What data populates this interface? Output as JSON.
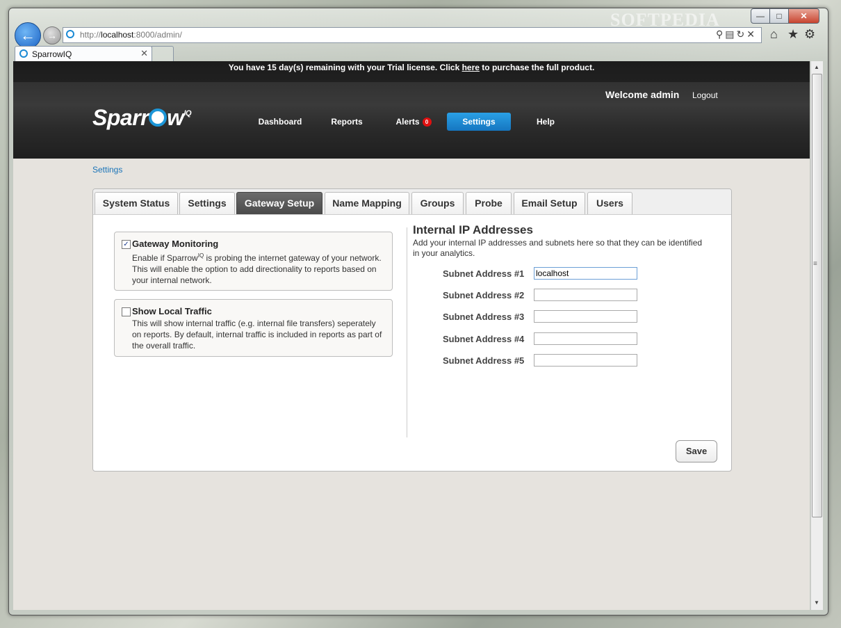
{
  "browser": {
    "watermark": "SOFTPEDIA",
    "url_prefix": "http://",
    "url_host": "localhost",
    "url_rest": ":8000/admin/",
    "tab_title": "SparrowIQ"
  },
  "site": {
    "trial_before": "You have 15 day(s) remaining with your Trial license. Click ",
    "trial_link": "here",
    "trial_after": " to purchase the full product.",
    "welcome": "Welcome admin",
    "logout": "Logout",
    "logo_a": "Sparr",
    "logo_b": "w",
    "logo_sup": "IQ",
    "nav": {
      "dashboard": "Dashboard",
      "reports": "Reports",
      "alerts": "Alerts",
      "alerts_count": "0",
      "settings": "Settings",
      "help": "Help"
    },
    "breadcrumb": "Settings"
  },
  "tabs": [
    "System Status",
    "Settings",
    "Gateway Setup",
    "Name Mapping",
    "Groups",
    "Probe",
    "Email Setup",
    "Users"
  ],
  "active_tab": "Gateway Setup",
  "options": {
    "gateway": {
      "checked": true,
      "title": "Gateway Monitoring",
      "desc_a": "Enable if Sparrow",
      "desc_sup": "IQ",
      "desc_b": " is probing the internet gateway of your network. This will enable the option to add directionality to reports based on your internal network."
    },
    "local": {
      "checked": false,
      "title": "Show Local Traffic",
      "desc": "This will show internal traffic (e.g. internal file transfers) seperately on reports. By default, internal traffic is included in reports as part of the overall traffic."
    }
  },
  "internal_ip": {
    "title": "Internal IP Addresses",
    "desc": "Add your internal IP addresses and subnets here so that they can be identified in your analytics.",
    "fields": [
      {
        "label": "Subnet Address #1",
        "value": "localhost"
      },
      {
        "label": "Subnet Address #2",
        "value": ""
      },
      {
        "label": "Subnet Address #3",
        "value": ""
      },
      {
        "label": "Subnet Address #4",
        "value": ""
      },
      {
        "label": "Subnet Address #5",
        "value": ""
      }
    ]
  },
  "save_label": "Save",
  "colors": {
    "accent": "#1c96d8",
    "active_tab": "#555555",
    "alert_badge": "#e01010"
  }
}
